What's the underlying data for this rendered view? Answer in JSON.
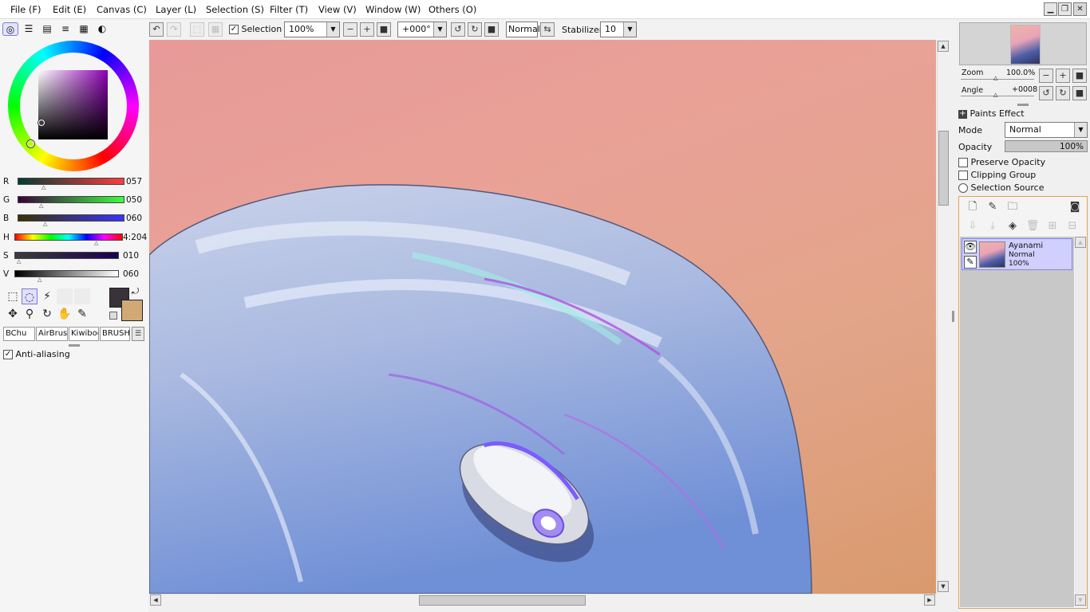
{
  "menu": [
    "File (F)",
    "Edit (E)",
    "Canvas (C)",
    "Layer (L)",
    "Selection (S)",
    "Filter (T)",
    "View (V)",
    "Window (W)",
    "Others (O)"
  ],
  "window_controls": {
    "minimize": "▁",
    "restore": "❐",
    "close": "✕"
  },
  "toolbar": {
    "selection_label": "Selection",
    "zoom_value": "100%",
    "angle_value": "+000°",
    "blend_label": "Normal",
    "stabilizer_label": "Stabilizer",
    "stabilizer_value": "10"
  },
  "color_sliders": [
    {
      "label": "R",
      "value": "057",
      "level": 0.22
    },
    {
      "label": "G",
      "value": "050",
      "level": 0.2
    },
    {
      "label": "B",
      "value": "060",
      "level": 0.24
    },
    {
      "label": "H",
      "value": "4:204",
      "level": 0.78
    },
    {
      "label": "S",
      "value": "010",
      "level": 0.04
    },
    {
      "label": "V",
      "value": "060",
      "level": 0.24
    }
  ],
  "colors": {
    "primary": "#393239",
    "secondary": "#d2a874",
    "accent": "#8080ff"
  },
  "brush_tabs": [
    "BChu",
    "AirBrush",
    "Kiwiboo",
    "BRUSHS"
  ],
  "anti_aliasing_label": "Anti-aliasing",
  "navigator": {
    "zoom_label": "Zoom",
    "zoom_value": "100.0%",
    "angle_label": "Angle",
    "angle_value": "+0008"
  },
  "layer_props": {
    "paints_effect": "Paints Effect",
    "mode_label": "Mode",
    "mode_value": "Normal",
    "opacity_label": "Opacity",
    "opacity_value": "100%",
    "preserve_opacity": "Preserve Opacity",
    "clipping_group": "Clipping Group",
    "selection_source": "Selection Source"
  },
  "layers": [
    {
      "name": "Ayanami",
      "mode": "Normal",
      "opacity": "100%"
    }
  ]
}
